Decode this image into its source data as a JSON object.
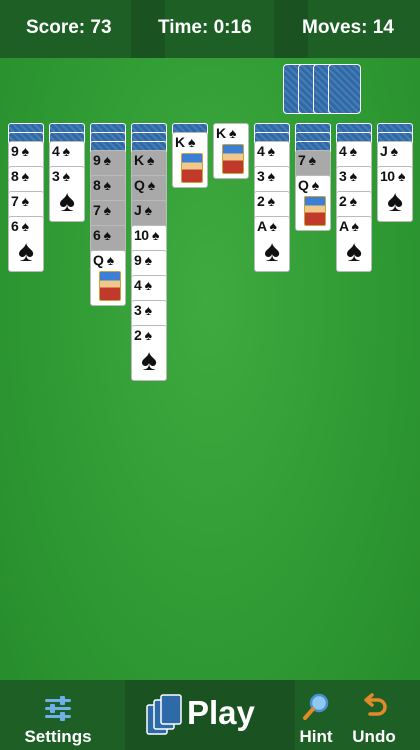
{
  "header": {
    "score": "Score: 73",
    "time": "Time: 0:16",
    "moves": "Moves: 14"
  },
  "stock_piles": 4,
  "card_colors": {
    "back": "#2f6aa8",
    "felt": "#2f9a33",
    "bar": "#1e5f26"
  },
  "tableau": [
    {
      "backs": 2,
      "cards": [
        {
          "rank": "9",
          "suit": "♠"
        },
        {
          "rank": "8",
          "suit": "♠"
        },
        {
          "rank": "7",
          "suit": "♠"
        },
        {
          "rank": "6",
          "suit": "♠"
        }
      ]
    },
    {
      "backs": 2,
      "cards": [
        {
          "rank": "4",
          "suit": "♠"
        },
        {
          "rank": "3",
          "suit": "♠"
        }
      ]
    },
    {
      "backs": 3,
      "cards": [
        {
          "rank": "9",
          "suit": "♠",
          "locked": true
        },
        {
          "rank": "8",
          "suit": "♠",
          "locked": true
        },
        {
          "rank": "7",
          "suit": "♠",
          "locked": true
        },
        {
          "rank": "6",
          "suit": "♠",
          "locked": true
        },
        {
          "rank": "Q",
          "suit": "♠",
          "face": true
        }
      ]
    },
    {
      "backs": 3,
      "cards": [
        {
          "rank": "K",
          "suit": "♠",
          "locked": true
        },
        {
          "rank": "Q",
          "suit": "♠",
          "locked": true
        },
        {
          "rank": "J",
          "suit": "♠",
          "locked": true
        },
        {
          "rank": "10",
          "suit": "♠"
        },
        {
          "rank": "9",
          "suit": "♠"
        },
        {
          "rank": "4",
          "suit": "♠"
        },
        {
          "rank": "3",
          "suit": "♠"
        },
        {
          "rank": "2",
          "suit": "♠"
        }
      ]
    },
    {
      "backs": 1,
      "cards": [
        {
          "rank": "K",
          "suit": "♠",
          "face": true
        }
      ]
    },
    {
      "backs": 0,
      "cards": [
        {
          "rank": "K",
          "suit": "♠",
          "face": true
        }
      ]
    },
    {
      "backs": 2,
      "cards": [
        {
          "rank": "4",
          "suit": "♠"
        },
        {
          "rank": "3",
          "suit": "♠"
        },
        {
          "rank": "2",
          "suit": "♠"
        },
        {
          "rank": "A",
          "suit": "♠"
        }
      ]
    },
    {
      "backs": 3,
      "cards": [
        {
          "rank": "7",
          "suit": "♠",
          "locked": true
        },
        {
          "rank": "Q",
          "suit": "♠",
          "face": true
        }
      ]
    },
    {
      "backs": 2,
      "cards": [
        {
          "rank": "4",
          "suit": "♠"
        },
        {
          "rank": "3",
          "suit": "♠"
        },
        {
          "rank": "2",
          "suit": "♠"
        },
        {
          "rank": "A",
          "suit": "♠"
        }
      ]
    },
    {
      "backs": 2,
      "cards": [
        {
          "rank": "J",
          "suit": "♠"
        },
        {
          "rank": "10",
          "suit": "♠"
        }
      ]
    }
  ],
  "toolbar": {
    "settings": "Settings",
    "play": "Play",
    "hint": "Hint",
    "undo": "Undo"
  }
}
